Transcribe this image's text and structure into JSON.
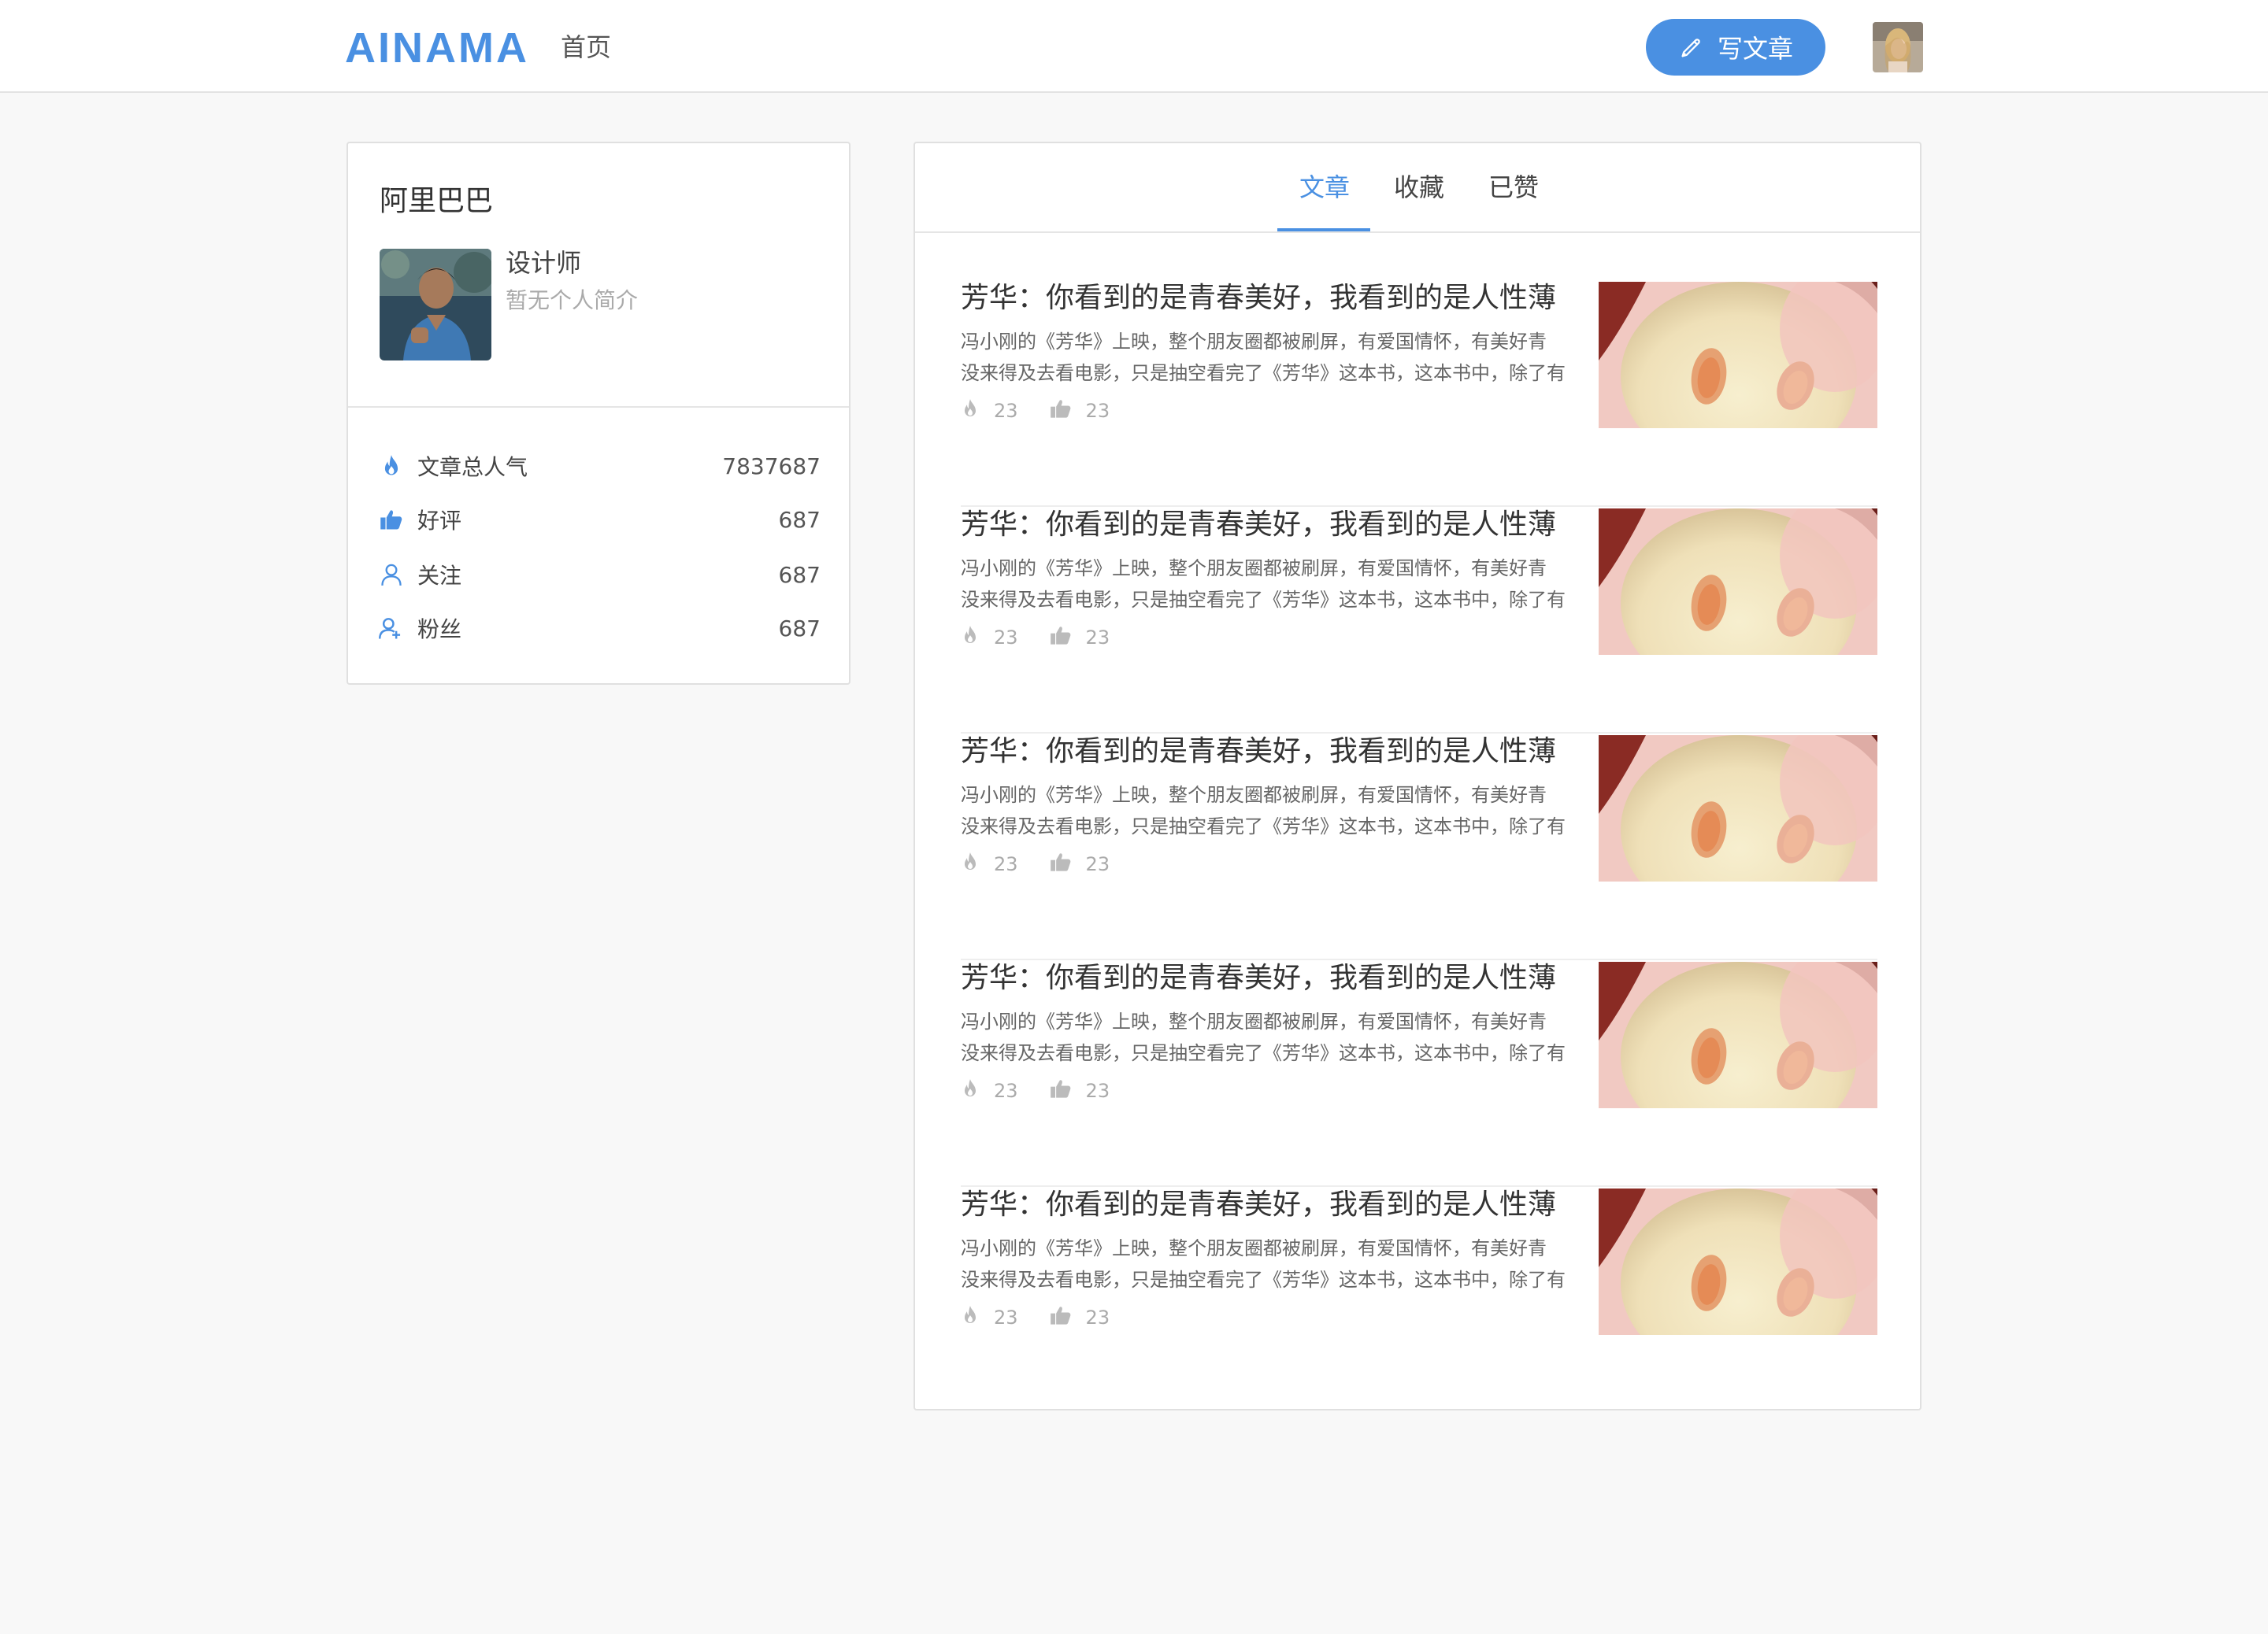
{
  "header": {
    "logo": "AINAMA",
    "nav_home": "首页",
    "write_button": "写文章"
  },
  "profile": {
    "name": "阿里巴巴",
    "role": "设计师",
    "bio": "暂无个人简介",
    "stats": [
      {
        "icon": "flame-icon",
        "label": "文章总人气",
        "value": "7837687"
      },
      {
        "icon": "thumbs-up-icon",
        "label": "好评",
        "value": "687"
      },
      {
        "icon": "user-icon",
        "label": "关注",
        "value": "687"
      },
      {
        "icon": "user-plus-icon",
        "label": "粉丝",
        "value": "687"
      }
    ]
  },
  "tabs": [
    {
      "label": "文章",
      "active": true
    },
    {
      "label": "收藏",
      "active": false
    },
    {
      "label": "已赞",
      "active": false
    }
  ],
  "articles": [
    {
      "title": "芳华：你看到的是青春美好，我看到的是人性薄",
      "summary_line1": "冯小刚的《芳华》上映，整个朋友圈都被刷屏，有爱国情怀，有美好青",
      "summary_line2": "没来得及去看电影，只是抽空看完了《芳华》这本书，这本书中，除了有",
      "views": "23",
      "likes": "23"
    },
    {
      "title": "芳华：你看到的是青春美好，我看到的是人性薄",
      "summary_line1": "冯小刚的《芳华》上映，整个朋友圈都被刷屏，有爱国情怀，有美好青",
      "summary_line2": "没来得及去看电影，只是抽空看完了《芳华》这本书，这本书中，除了有",
      "views": "23",
      "likes": "23"
    },
    {
      "title": "芳华：你看到的是青春美好，我看到的是人性薄",
      "summary_line1": "冯小刚的《芳华》上映，整个朋友圈都被刷屏，有爱国情怀，有美好青",
      "summary_line2": "没来得及去看电影，只是抽空看完了《芳华》这本书，这本书中，除了有",
      "views": "23",
      "likes": "23"
    },
    {
      "title": "芳华：你看到的是青春美好，我看到的是人性薄",
      "summary_line1": "冯小刚的《芳华》上映，整个朋友圈都被刷屏，有爱国情怀，有美好青",
      "summary_line2": "没来得及去看电影，只是抽空看完了《芳华》这本书，这本书中，除了有",
      "views": "23",
      "likes": "23"
    },
    {
      "title": "芳华：你看到的是青春美好，我看到的是人性薄",
      "summary_line1": "冯小刚的《芳华》上映，整个朋友圈都被刷屏，有爱国情怀，有美好青",
      "summary_line2": "没来得及去看电影，只是抽空看完了《芳华》这本书，这本书中，除了有",
      "views": "23",
      "likes": "23"
    }
  ],
  "colors": {
    "accent": "#4a90e2",
    "background": "#f8f8f8",
    "card": "#ffffff",
    "muted_text": "#aaaaaa"
  }
}
